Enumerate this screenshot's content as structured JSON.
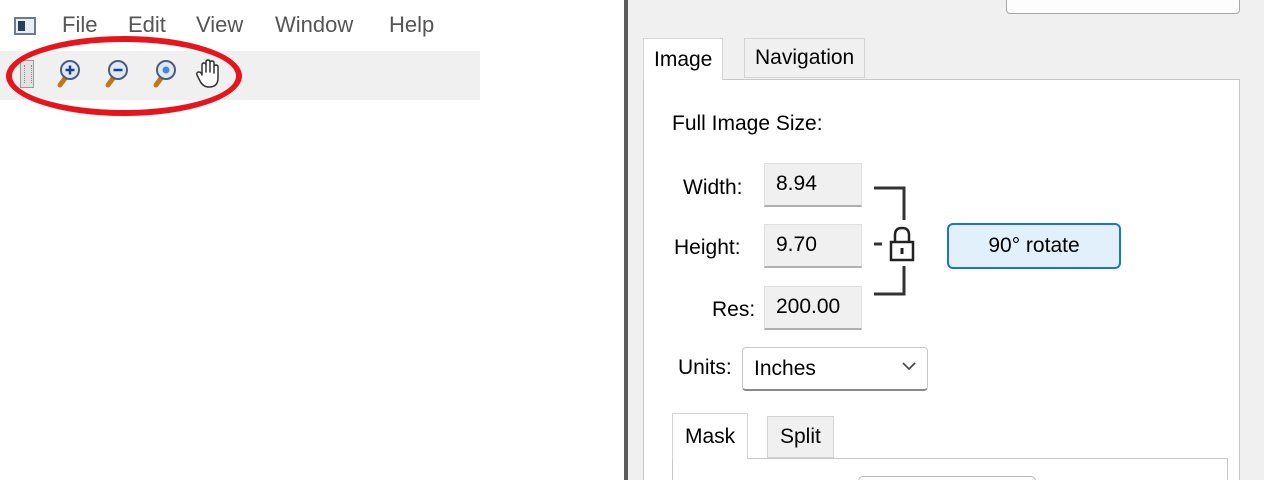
{
  "menubar": {
    "items": [
      "File",
      "Edit",
      "View",
      "Window",
      "Help"
    ]
  },
  "toolbar": {
    "buttons": [
      "zoom-in-icon",
      "zoom-out-icon",
      "zoom-fit-icon",
      "pan-hand-icon"
    ],
    "highlight_color": "#e8141c"
  },
  "dialog": {
    "tabs": [
      "Image",
      "Navigation"
    ],
    "active_tab": "Image",
    "full_image_size_label": "Full Image Size:",
    "width_label": "Width:",
    "width_value": "8.94",
    "height_label": "Height:",
    "height_value": "9.70",
    "res_label": "Res:",
    "res_value": "200.00",
    "lock_icon": "padlock-icon",
    "rotate_label": "90° rotate",
    "units_label": "Units:",
    "units_value": "Inches",
    "subtabs": [
      "Mask",
      "Split"
    ],
    "active_subtab": "Mask",
    "accent_color": "#1a77c8"
  }
}
